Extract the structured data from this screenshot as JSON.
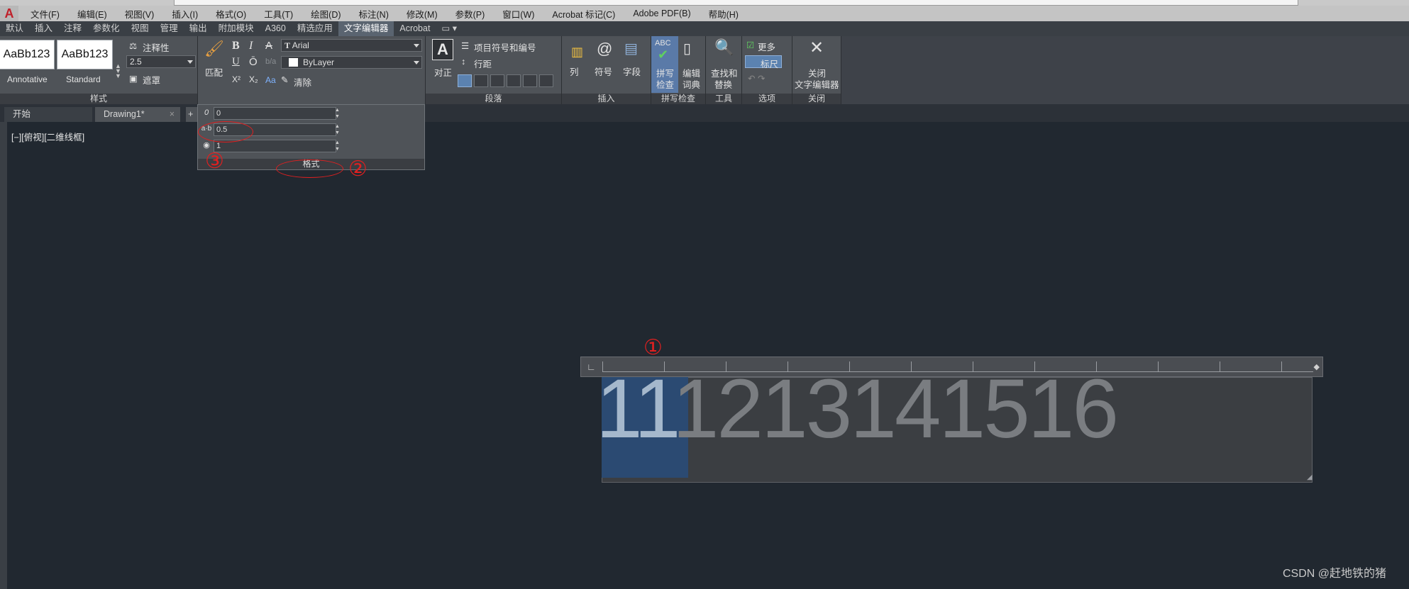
{
  "menubar": {
    "items": [
      "文件(F)",
      "编辑(E)",
      "视图(V)",
      "插入(I)",
      "格式(O)",
      "工具(T)",
      "绘图(D)",
      "标注(N)",
      "修改(M)",
      "参数(P)",
      "窗口(W)",
      "Acrobat 标记(C)",
      "Adobe PDF(B)",
      "帮助(H)"
    ]
  },
  "ribbon_tabs": [
    "默认",
    "插入",
    "注释",
    "参数化",
    "视图",
    "管理",
    "输出",
    "附加模块",
    "A360",
    "精选应用",
    "文字编辑器",
    "Acrobat",
    "▭ ▾"
  ],
  "style_panel": {
    "style1": "AaBb123",
    "style1_name": "Annotative",
    "style2": "AaBb123",
    "style2_name": "Standard",
    "annot": "注释性",
    "height": "2.5",
    "mask": "遮罩",
    "label": "样式"
  },
  "format_panel": {
    "match": "匹配",
    "bold": "B",
    "italic": "I",
    "strike": "A",
    "underline": "U",
    "overline": "Ō",
    "font": "Arial",
    "color": "ByLayer",
    "sup": "X²",
    "sub": "X₂",
    "case": "Aa",
    "clear": "清除"
  },
  "paragraph_panel": {
    "justify": "对正",
    "bullets": "项目符号和编号",
    "spacing": "行距",
    "label": "段落"
  },
  "insert_panel": {
    "columns": "列",
    "symbol": "符号",
    "field": "字段",
    "label": "插入"
  },
  "spell_panel": {
    "spell1": "拼写",
    "spell2": "检查",
    "dict1": "编辑",
    "dict2": "词典",
    "label": "拼写检查"
  },
  "tools_panel": {
    "find1": "查找和",
    "find2": "替换",
    "label": "工具"
  },
  "options_panel": {
    "more": "更多",
    "ruler": "标尺",
    "label": "选项"
  },
  "close_panel": {
    "close1": "关闭",
    "close2": "文字编辑器",
    "label": "关闭"
  },
  "doc_tabs": [
    "开始",
    "Drawing1*"
  ],
  "view_label": "[−][俯视][二维线框]",
  "format_dropdown": {
    "oblique": "0",
    "tracking": "0.5",
    "width": "1",
    "bar_label": "格式"
  },
  "editor": {
    "selected": "11",
    "rest": "1213141516"
  },
  "annotations": [
    "①",
    "②",
    "③"
  ],
  "watermark": "CSDN @赶地铁的猪",
  "colors": {
    "accent": "#5a6470",
    "selection": "#2b4a72",
    "annotation": "#e02020"
  }
}
